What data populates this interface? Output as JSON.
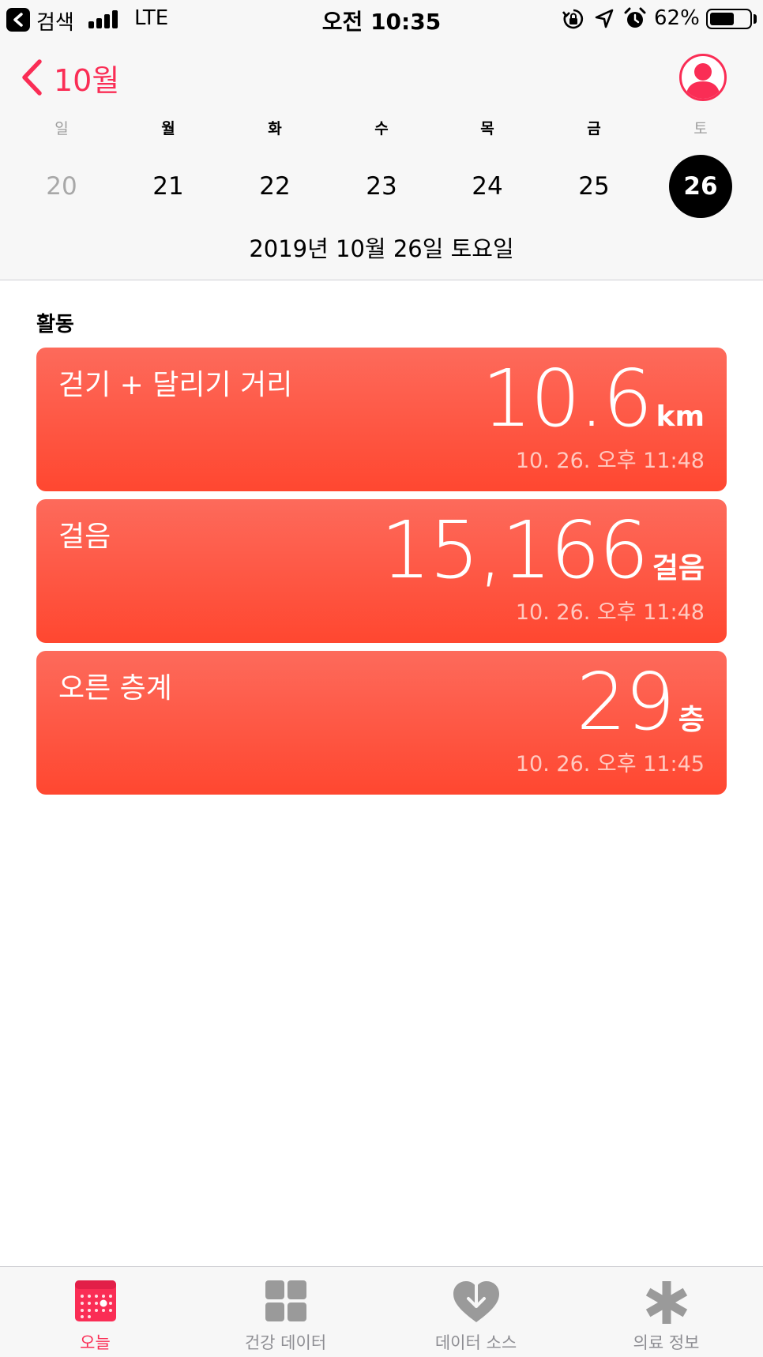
{
  "status_bar": {
    "back_label": "검색",
    "network": "LTE",
    "time": "오전 10:35",
    "battery_percent_label": "62%",
    "battery_level": 0.62
  },
  "header": {
    "back_label": "10월",
    "accent_color": "#fa2d55",
    "week": [
      {
        "name": "일",
        "num": "20",
        "state": "muted"
      },
      {
        "name": "월",
        "num": "21",
        "state": "normal"
      },
      {
        "name": "화",
        "num": "22",
        "state": "normal"
      },
      {
        "name": "수",
        "num": "23",
        "state": "normal"
      },
      {
        "name": "목",
        "num": "24",
        "state": "normal"
      },
      {
        "name": "금",
        "num": "25",
        "state": "normal"
      },
      {
        "name": "토",
        "num": "26",
        "state": "selected"
      }
    ],
    "date_label": "2019년 10월 26일 토요일"
  },
  "activity": {
    "section_title": "활동",
    "card_color": "#ff4f3a",
    "cards": [
      {
        "title": "걷기 + 달리기 거리",
        "value": "10.6",
        "unit": "km",
        "time": "10. 26. 오후 11:48"
      },
      {
        "title": "걸음",
        "value": "15,166",
        "unit": "걸음",
        "time": "10. 26. 오후 11:48"
      },
      {
        "title": "오른 층계",
        "value": "29",
        "unit": "층",
        "time": "10. 26. 오후 11:45"
      }
    ]
  },
  "tab_bar": {
    "tabs": [
      {
        "label": "오늘",
        "icon": "calendar-icon",
        "active": true
      },
      {
        "label": "건강 데이터",
        "icon": "grid-icon",
        "active": false
      },
      {
        "label": "데이터 소스",
        "icon": "heart-download-icon",
        "active": false
      },
      {
        "label": "의료 정보",
        "icon": "asterisk-icon",
        "active": false
      }
    ]
  }
}
